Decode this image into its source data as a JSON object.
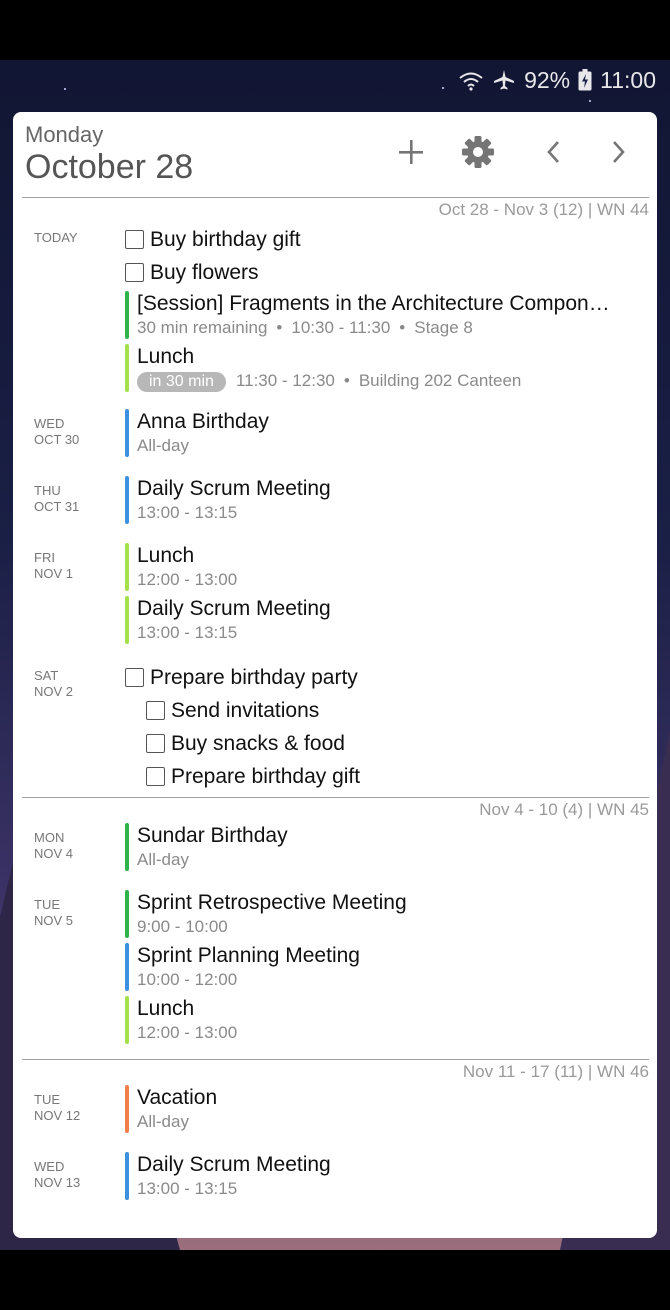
{
  "status_bar": {
    "battery": "92%",
    "time": "11:00",
    "icons": [
      "wifi-icon",
      "airplane-icon",
      "battery-charging-icon"
    ]
  },
  "header": {
    "weekday": "Monday",
    "date": "October 28",
    "icons": [
      "add-icon",
      "settings-icon",
      "chevron-left-icon",
      "chevron-right-icon"
    ]
  },
  "colors": {
    "green": "#2db34a",
    "lime": "#a4e04a",
    "blue": "#3d8fe0",
    "orange": "#f07f4c"
  },
  "weeks": [
    {
      "label": "Oct 28 - Nov 3 (12) | WN 44",
      "days": [
        {
          "label_1": "TODAY",
          "label_2": "",
          "tasks": [
            "Buy birthday gift",
            "Buy flowers"
          ],
          "events": [
            {
              "title": "[Session] Fragments in the Architecture Compon…",
              "remaining": "30 min remaining",
              "time": "10:30 - 11:30",
              "location": "Stage 8",
              "color": "green"
            },
            {
              "title": "Lunch",
              "badge": "in 30 min",
              "time": "11:30 - 12:30",
              "location": "Building 202 Canteen",
              "color": "lime"
            }
          ]
        },
        {
          "label_1": "WED",
          "label_2": "OCT 30",
          "events": [
            {
              "title": "Anna Birthday",
              "time": "All-day",
              "color": "blue"
            }
          ]
        },
        {
          "label_1": "THU",
          "label_2": "OCT 31",
          "events": [
            {
              "title": "Daily Scrum Meeting",
              "time": "13:00 - 13:15",
              "color": "blue"
            }
          ]
        },
        {
          "label_1": "FRI",
          "label_2": "NOV 1",
          "events": [
            {
              "title": "Lunch",
              "time": "12:00 - 13:00",
              "color": "lime"
            },
            {
              "title": "Daily Scrum Meeting",
              "time": "13:00 - 13:15",
              "color": "lime"
            }
          ]
        },
        {
          "label_1": "SAT",
          "label_2": "NOV 2",
          "task": "Prepare birthday party",
          "subtasks": [
            "Send invitations",
            "Buy snacks & food",
            "Prepare birthday gift"
          ]
        }
      ]
    },
    {
      "label": "Nov 4 - 10 (4) | WN 45",
      "days": [
        {
          "label_1": "MON",
          "label_2": "NOV 4",
          "events": [
            {
              "title": "Sundar Birthday",
              "time": "All-day",
              "color": "green"
            }
          ]
        },
        {
          "label_1": "TUE",
          "label_2": "NOV 5",
          "events": [
            {
              "title": "Sprint Retrospective Meeting",
              "time": "9:00 - 10:00",
              "color": "green"
            },
            {
              "title": "Sprint Planning Meeting",
              "time": "10:00 - 12:00",
              "color": "blue"
            },
            {
              "title": "Lunch",
              "time": "12:00 - 13:00",
              "color": "lime"
            }
          ]
        }
      ]
    },
    {
      "label": "Nov 11 - 17 (11) | WN 46",
      "days": [
        {
          "label_1": "TUE",
          "label_2": "NOV 12",
          "events": [
            {
              "title": "Vacation",
              "time": "All-day",
              "color": "orange"
            }
          ]
        },
        {
          "label_1": "WED",
          "label_2": "NOV 13",
          "events": [
            {
              "title": "Daily Scrum Meeting",
              "time": "13:00 - 13:15",
              "color": "blue"
            }
          ]
        }
      ]
    }
  ]
}
